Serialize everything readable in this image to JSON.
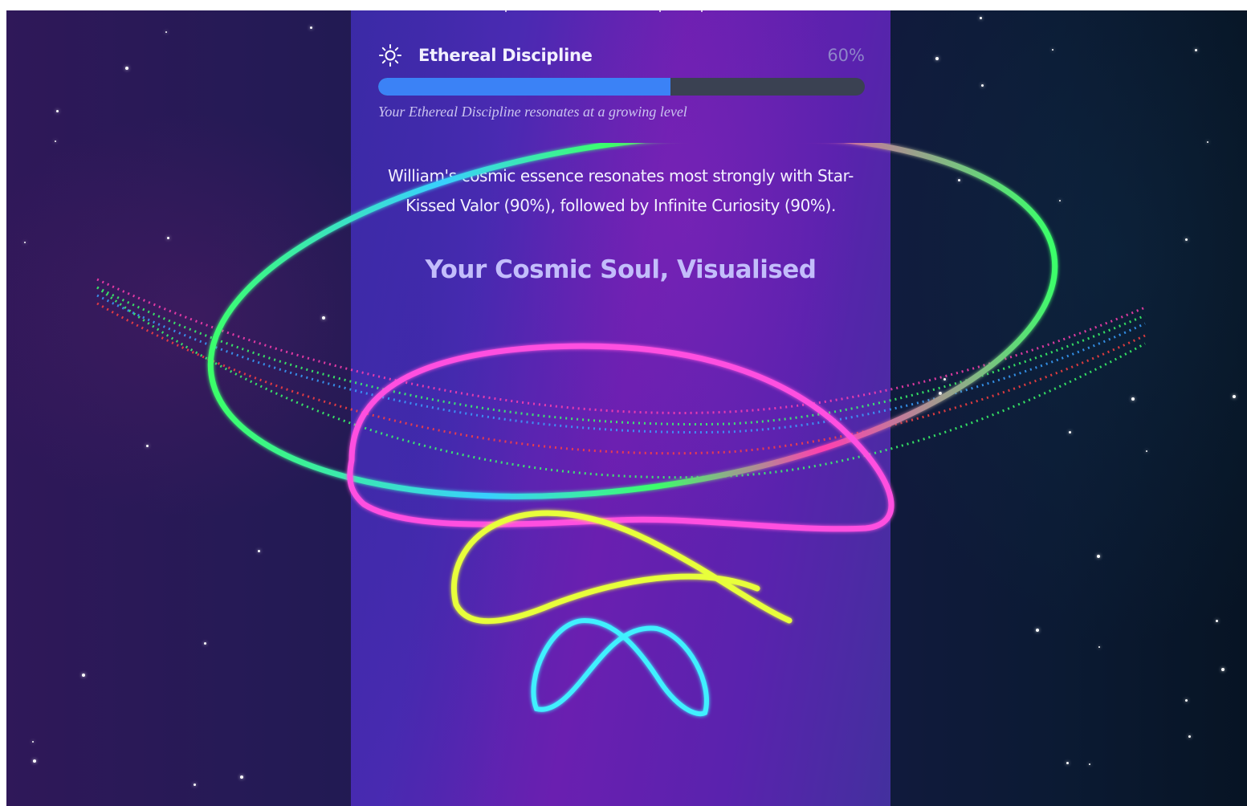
{
  "trait": {
    "name": "Ethereal Discipline",
    "percent_label": "60%",
    "level": 0.6,
    "note": "Your Ethereal Discipline resonates at a growing level",
    "icon": "sun-icon",
    "bar_color": "#3b82f6",
    "track_color": "#3a4152"
  },
  "summary": {
    "text": "William's cosmic essence resonates most strongly with Star-Kissed Valor (90%), followed by Infinite Curiosity (90%)."
  },
  "visual": {
    "heading": "Your Cosmic Soul, Visualised",
    "ribbon_colors": [
      "#ff4fe0",
      "#e8ff3a",
      "#3ff0ff",
      "#3bff6a"
    ]
  }
}
